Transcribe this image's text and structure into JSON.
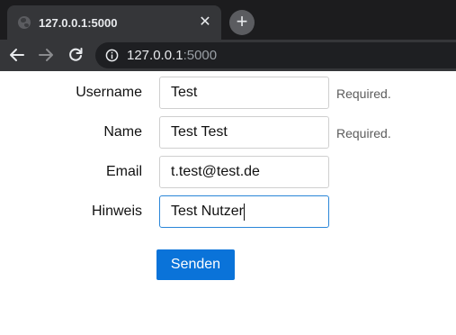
{
  "browser": {
    "tab_title": "127.0.0.1:5000",
    "close_glyph": "✕",
    "newtab_glyph": "+",
    "url_host": "127.0.0.1",
    "url_port": ":5000"
  },
  "form": {
    "fields": [
      {
        "label": "Username",
        "value": "Test",
        "hint": "Required."
      },
      {
        "label": "Name",
        "value": "Test Test",
        "hint": "Required."
      },
      {
        "label": "Email",
        "value": "t.test@test.de",
        "hint": ""
      },
      {
        "label": "Hinweis",
        "value": "Test Nutzer",
        "hint": ""
      }
    ],
    "submit_label": "Senden"
  },
  "colors": {
    "accent": "#0a73d9",
    "focus_border": "#2a86d8",
    "chrome_dark": "#1c1c1e",
    "chrome_toolbar": "#353639"
  }
}
